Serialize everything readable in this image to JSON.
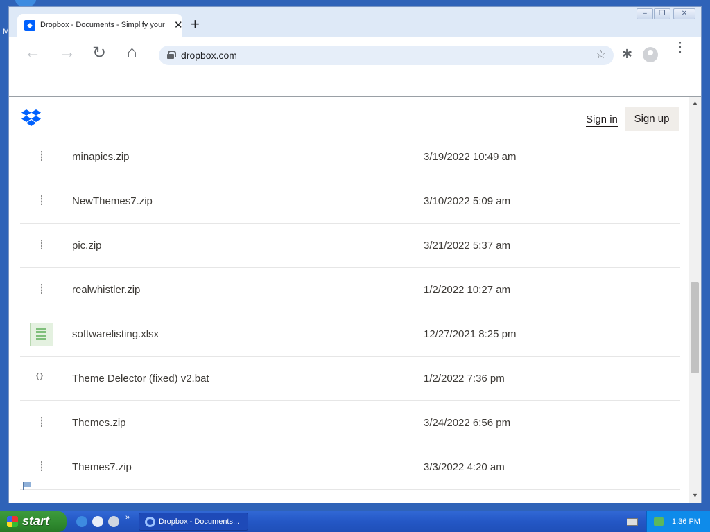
{
  "desktop": {
    "edge_letter": "M"
  },
  "browser": {
    "tab_title": "Dropbox - Documents - Simplify your",
    "tab_close": "✕",
    "new_tab": "+",
    "window_buttons": [
      "‒",
      "❐",
      "✕"
    ],
    "url": "dropbox.com",
    "icons": {
      "back": "←",
      "forward": "→",
      "reload": "↻",
      "home": "⌂",
      "star": "☆",
      "extensions": "✱",
      "menu": "⋮"
    }
  },
  "site": {
    "sign_in": "Sign in",
    "sign_up": "Sign up",
    "brand_color": "#0061fe"
  },
  "files": [
    {
      "name": "minapics.zip",
      "date": "3/19/2022 10:49 am",
      "type": "zip"
    },
    {
      "name": "NewThemes7.zip",
      "date": "3/10/2022 5:09 am",
      "type": "zip"
    },
    {
      "name": "pic.zip",
      "date": "3/21/2022 5:37 am",
      "type": "zip"
    },
    {
      "name": "realwhistler.zip",
      "date": "1/2/2022 10:27 am",
      "type": "zip"
    },
    {
      "name": "softwarelisting.xlsx",
      "date": "12/27/2021 8:25 pm",
      "type": "xlsx"
    },
    {
      "name": "Theme Delector (fixed) v2.bat",
      "date": "1/2/2022 7:36 pm",
      "type": "bat"
    },
    {
      "name": "Themes.zip",
      "date": "3/24/2022 6:56 pm",
      "type": "zip"
    },
    {
      "name": "Themes7.zip",
      "date": "3/3/2022 4:20 am",
      "type": "zip"
    }
  ],
  "scrollbar": {
    "up": "▲",
    "down": "▼"
  },
  "taskbar": {
    "start_label": "start",
    "quick_launch_more": "»",
    "task_label": "Dropbox - Documents...",
    "clock": "1:36 PM"
  }
}
